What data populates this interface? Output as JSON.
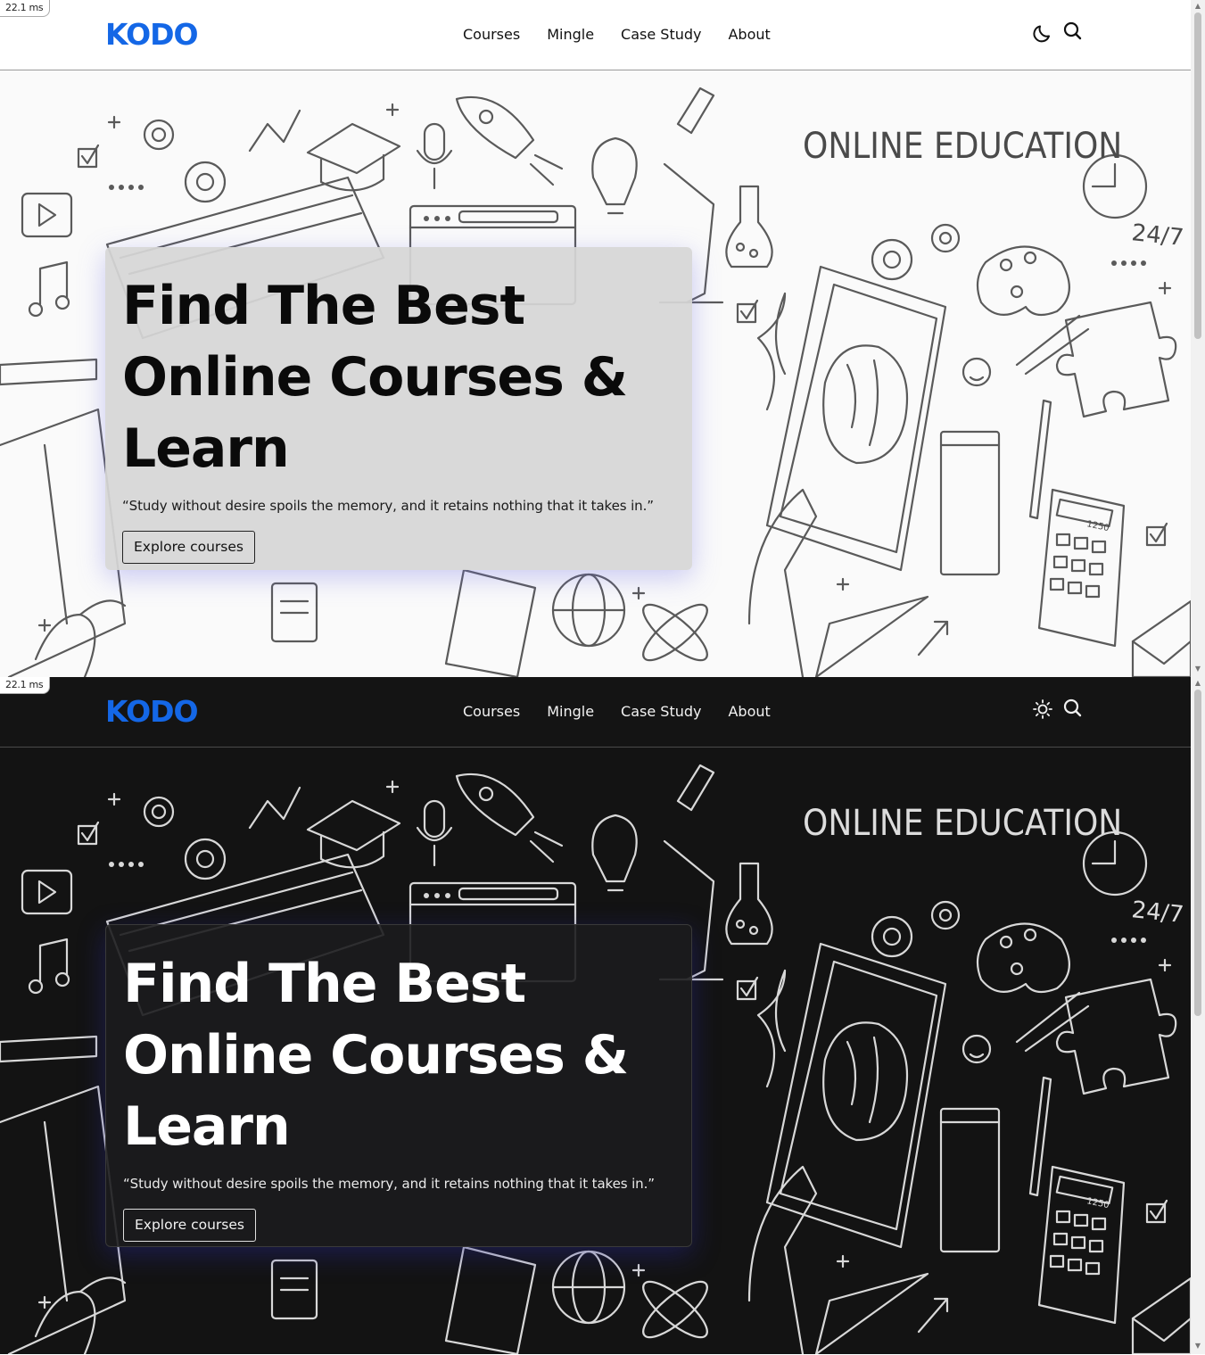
{
  "perf": {
    "timing": "22.1 ms"
  },
  "brand": {
    "logo": "KODO"
  },
  "nav": {
    "links": [
      "Courses",
      "Mingle",
      "Case Study",
      "About"
    ]
  },
  "header_icons": {
    "light_mode_toggle": "moon-icon",
    "dark_mode_toggle": "sun-icon",
    "search": "search-icon"
  },
  "hero": {
    "background_text": {
      "title": "ONLINE EDUCATION",
      "badge": "24/7",
      "calculator": "1250"
    },
    "title_line1": "Find The Best",
    "title_line2": "Online Courses &",
    "title_line3": "Learn",
    "quote": "“Study without desire spoils the memory, and it retains nothing that it takes in.”",
    "cta": "Explore courses"
  },
  "colors": {
    "brand": "#1467e6",
    "light_bg": "#ffffff",
    "dark_bg": "#141414"
  }
}
